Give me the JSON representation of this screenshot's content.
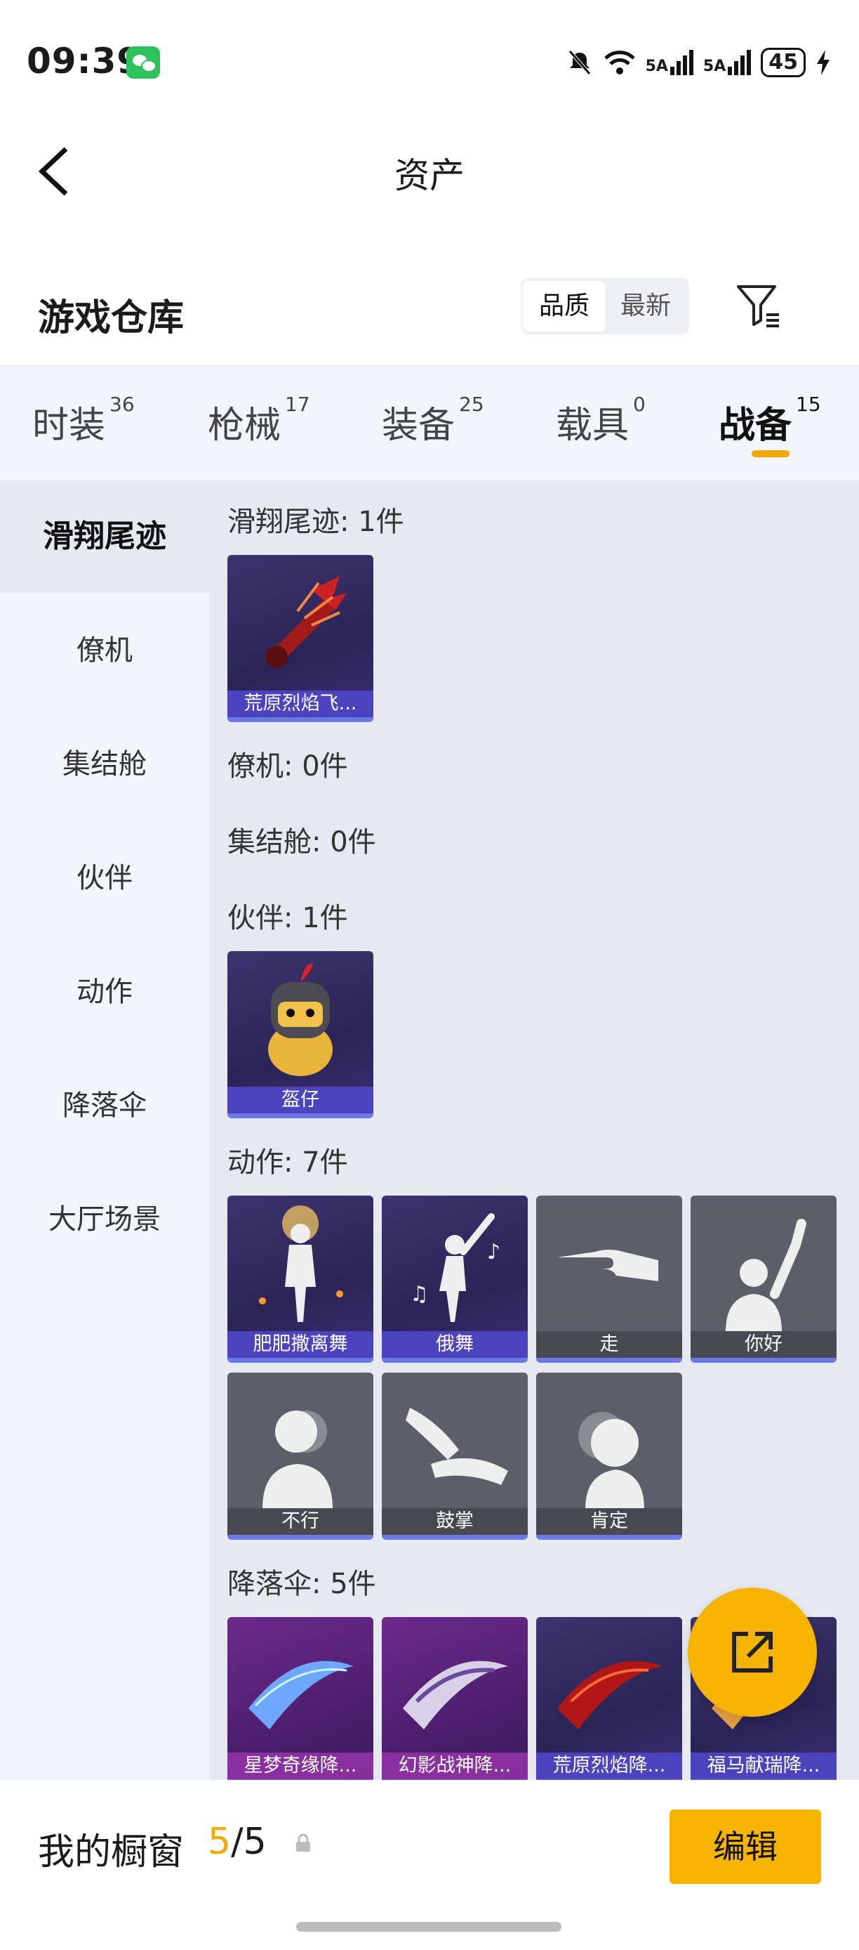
{
  "status_bar": {
    "time": "09:39",
    "signal1": "5A",
    "signal2": "5A",
    "battery": "45"
  },
  "header": {
    "back_icon": "chevron-left-icon",
    "title": "资产"
  },
  "warehouse": {
    "title": "游戏仓库",
    "sort_options": [
      "品质",
      "最新"
    ],
    "active_sort": "品质",
    "filter_icon": "filter-icon"
  },
  "tabs": [
    {
      "label": "时装",
      "count": "36"
    },
    {
      "label": "枪械",
      "count": "17"
    },
    {
      "label": "装备",
      "count": "25"
    },
    {
      "label": "载具",
      "count": "0"
    },
    {
      "label": "战备",
      "count": "15",
      "active": true
    }
  ],
  "sidebar": {
    "items": [
      "滑翔尾迹",
      "僚机",
      "集结舱",
      "伙伴",
      "动作",
      "降落伞",
      "大厅场景"
    ],
    "active": "滑翔尾迹"
  },
  "sections": {
    "glide": {
      "title": "滑翔尾迹: 1件",
      "items": [
        "荒原烈焰飞..."
      ]
    },
    "wingman": {
      "title": "僚机: 0件"
    },
    "pod": {
      "title": "集结舱: 0件"
    },
    "partner": {
      "title": "伙伴: 1件",
      "items": [
        "盔仔"
      ]
    },
    "emote": {
      "title": "动作: 7件",
      "items": [
        "肥肥撒离舞",
        "俄舞",
        "走",
        "你好",
        "不行",
        "鼓掌",
        "肯定"
      ]
    },
    "parachute": {
      "title": "降落伞: 5件",
      "items": [
        "星梦奇缘降...",
        "幻影战神降...",
        "荒原烈焰降...",
        "福马献瑞降..."
      ]
    }
  },
  "fab": {
    "icon": "share-icon"
  },
  "bottom_bar": {
    "title": "我的橱窗",
    "count_current": "5",
    "count_sep": "/",
    "count_total": "5",
    "lock_icon": "lock-icon",
    "edit_label": "编辑"
  },
  "colors": {
    "accent": "#f6b400",
    "card_purple": "#2b2455",
    "card_grey": "#5d5f68"
  }
}
